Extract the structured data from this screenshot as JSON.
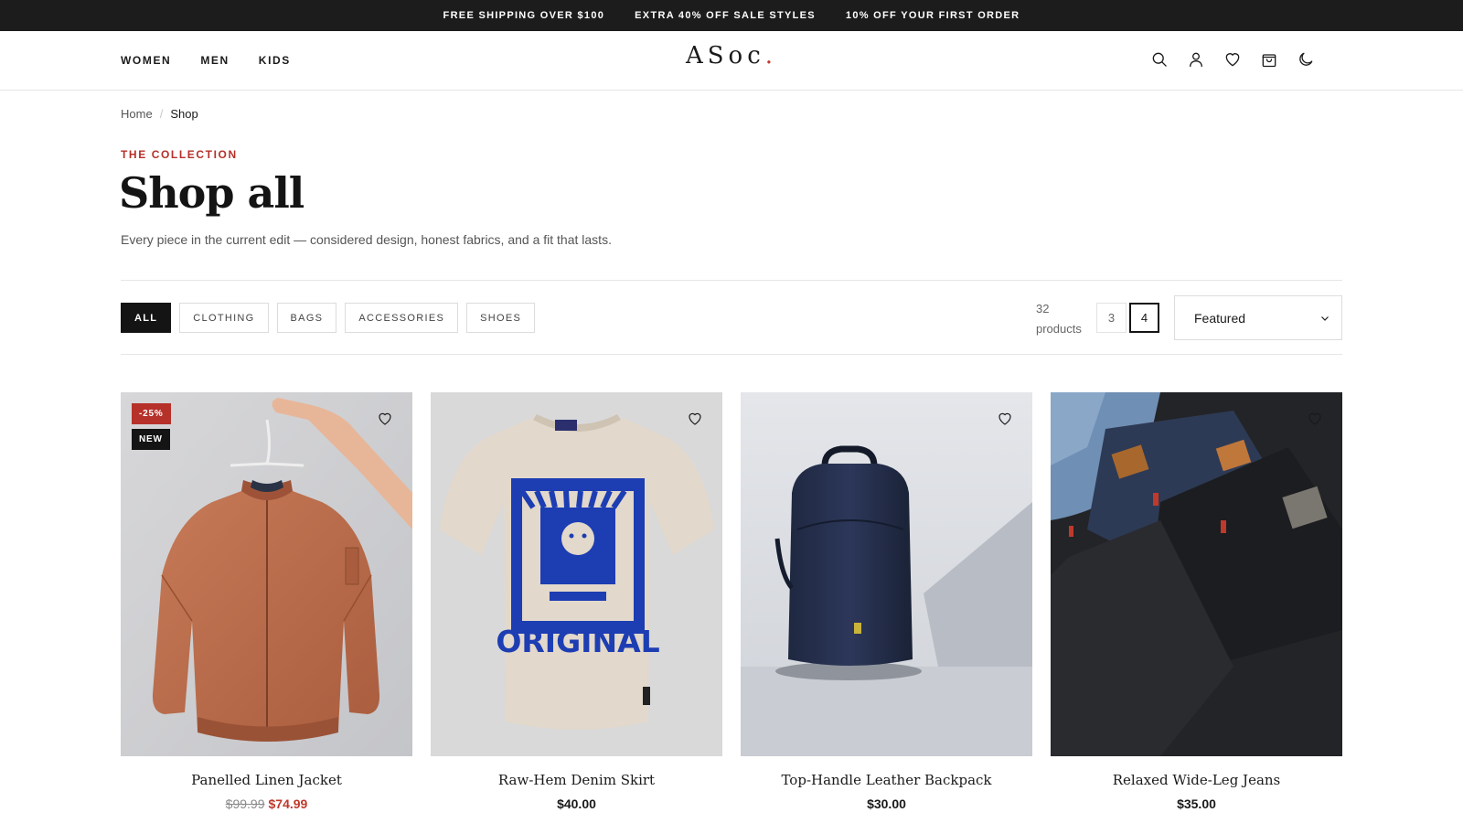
{
  "announcement": {
    "items": [
      "FREE SHIPPING OVER $100",
      "EXTRA 40% OFF SALE STYLES",
      "10% OFF YOUR FIRST ORDER"
    ]
  },
  "header": {
    "nav": [
      "WOMEN",
      "MEN",
      "KIDS"
    ],
    "logo": "ASoc",
    "logo_dot": ".",
    "icons": [
      "search-icon",
      "account-icon",
      "wishlist-icon",
      "bag-icon",
      "dark-mode-icon"
    ]
  },
  "breadcrumb": {
    "home": "Home",
    "separator": "/",
    "current": "Shop"
  },
  "hero": {
    "eyebrow": "THE COLLECTION",
    "title": "Shop all",
    "subtitle": "Every piece in the current edit — considered design, honest fabrics, and a fit that lasts."
  },
  "toolbar": {
    "filters": [
      "ALL",
      "CLOTHING",
      "BAGS",
      "ACCESSORIES",
      "SHOES"
    ],
    "active_filter": "ALL",
    "count_number": "32",
    "count_label": "products",
    "columns": [
      "3",
      "4"
    ],
    "active_columns": "4",
    "sort": {
      "selected": "Featured"
    }
  },
  "products": [
    {
      "name": "Panelled Linen Jacket",
      "old_price": "$99.99",
      "price": "$74.99",
      "badges": [
        "-25%",
        "NEW"
      ]
    },
    {
      "name": "Raw-Hem Denim Skirt",
      "price": "$40.00",
      "shirt_text": "ORIGINAL"
    },
    {
      "name": "Top-Handle Leather Backpack",
      "price": "$30.00"
    },
    {
      "name": "Relaxed Wide-Leg Jeans",
      "price": "$35.00"
    }
  ],
  "colors": {
    "accent": "#b5312a",
    "dark": "#1c1c1c",
    "sale_price": "#c0392b"
  }
}
